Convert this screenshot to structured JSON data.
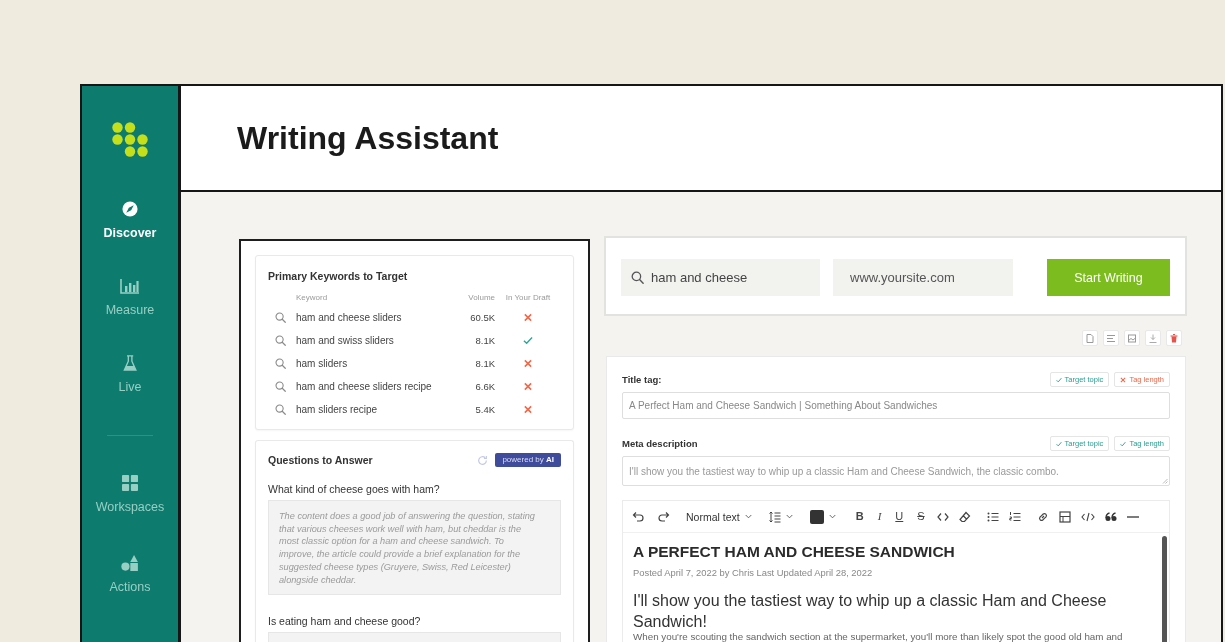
{
  "sidebar": {
    "groups": [
      {
        "items": [
          {
            "kind": "compass",
            "label": "Discover",
            "selected": true
          },
          {
            "kind": "chart",
            "label": "Measure",
            "selected": false
          },
          {
            "kind": "flask",
            "label": "Live",
            "selected": false
          }
        ]
      },
      {
        "items": [
          {
            "kind": "grid",
            "label": "Workspaces",
            "selected": false
          },
          {
            "kind": "shapes",
            "label": "Actions",
            "selected": false
          }
        ]
      }
    ]
  },
  "header": {
    "title": "Writing Assistant"
  },
  "keywords": {
    "title": "Primary Keywords to Target",
    "columns": [
      "Keyword",
      "Volume",
      "In Your Draft"
    ],
    "rows": [
      {
        "keyword": "ham and cheese sliders",
        "volume": "60.5K",
        "in_draft": false
      },
      {
        "keyword": "ham and swiss sliders",
        "volume": "8.1K",
        "in_draft": true
      },
      {
        "keyword": "ham sliders",
        "volume": "8.1K",
        "in_draft": false
      },
      {
        "keyword": "ham and cheese sliders recipe",
        "volume": "6.6K",
        "in_draft": false
      },
      {
        "keyword": "ham sliders recipe",
        "volume": "5.4K",
        "in_draft": false
      }
    ]
  },
  "questions": {
    "title": "Questions to Answer",
    "badge": "powered by **AI**",
    "items": [
      {
        "question": "What kind of cheese goes with ham?",
        "answer": "The content does a good job of answering the question, stating that various cheeses work well with ham, but cheddar is the most classic option for a ham and cheese sandwich. To improve, the article could provide a brief explanation for the suggested cheese types (Gruyere, Swiss, Red Leicester) alongside cheddar."
      },
      {
        "question": "Is eating ham and cheese good?"
      }
    ]
  },
  "search": {
    "query": "ham and cheese",
    "site": "www.yoursite.com",
    "button": "Start Writing"
  },
  "seo": {
    "fields": [
      {
        "kind": "input",
        "label": "Title tag:",
        "value": "A Perfect Ham and Cheese Sandwich | Something About Sandwiches",
        "checks": [
          {
            "label": "Target topic",
            "passed": true
          },
          {
            "label": "Tag length",
            "passed": false
          }
        ]
      },
      {
        "kind": "textarea",
        "label": "Meta description",
        "value": "I'll show you the tastiest way to whip up a classic Ham and Cheese Sandwich, the classic combo.",
        "checks": [
          {
            "label": "Target topic",
            "passed": true
          },
          {
            "label": "Tag length",
            "passed": true
          }
        ]
      }
    ]
  },
  "editor": {
    "text_style": "Normal text",
    "format_buttons": [
      {
        "kind": "bold",
        "label": "B"
      },
      {
        "kind": "italic",
        "label": "I"
      },
      {
        "kind": "underline",
        "label": "U"
      },
      {
        "kind": "strike",
        "label": "S"
      }
    ],
    "heading": "A PERFECT HAM AND CHEESE SANDWICH",
    "byline": "Posted April 7, 2022 by Chris Last Updated April 28, 2022",
    "intro": "I'll show you the tastiest way to whip up a classic Ham and Cheese Sandwich!",
    "body": "When you're scouting the sandwich section at the supermarket, you'll more than likely spot the good old ham and"
  }
}
